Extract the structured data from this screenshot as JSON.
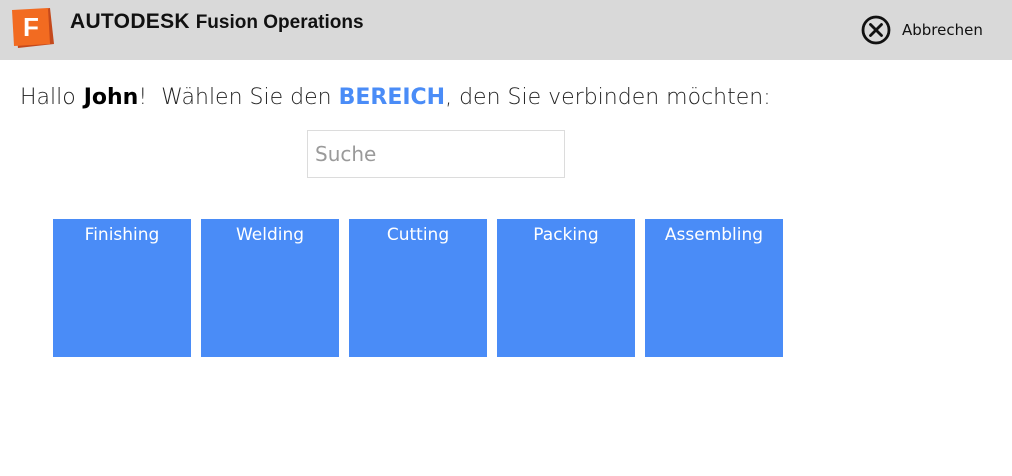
{
  "header": {
    "logo_letter": "F",
    "brand": "AUTODESK",
    "product": "Fusion Operations",
    "cancel_label": "Abbrechen"
  },
  "greeting": {
    "hello": "Hallo",
    "user": "John",
    "exclamation": "!",
    "prompt_before": "Wählen Sie den",
    "area_word": "BEREICH",
    "prompt_after": ", den Sie verbinden möchten:"
  },
  "search": {
    "placeholder": "Suche",
    "value": ""
  },
  "areas": [
    {
      "label": "Finishing"
    },
    {
      "label": "Welding"
    },
    {
      "label": "Cutting"
    },
    {
      "label": "Packing"
    },
    {
      "label": "Assembling"
    }
  ],
  "colors": {
    "header_bg": "#d9d9d9",
    "accent": "#4a8cf7",
    "logo_orange": "#f26b21"
  }
}
